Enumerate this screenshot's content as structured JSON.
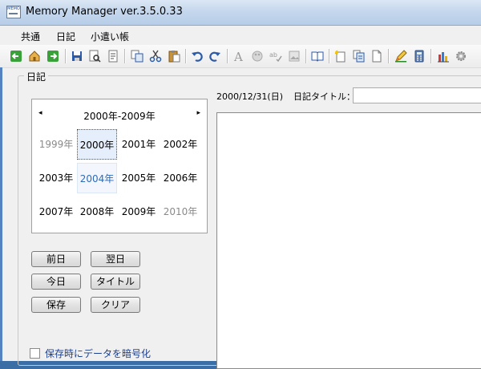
{
  "window": {
    "title": "Memory Manager ver.3.5.0.33",
    "icon": "memo-app-icon"
  },
  "menu": [
    "共通",
    "日記",
    "小遣い帳"
  ],
  "toolbar": {
    "icons": [
      "back-arrow-icon",
      "home-icon",
      "forward-arrow-icon",
      "save-icon",
      "print-preview-icon",
      "print-icon",
      "copy-icon",
      "cut-icon",
      "paste-icon",
      "undo-icon",
      "redo-icon",
      "font-icon",
      "color-icon",
      "spell-check-icon",
      "image-icon",
      "open-book-icon",
      "new-document-icon",
      "multi-document-icon",
      "document-icon",
      "edit-icon",
      "calculator-icon",
      "chart-icon",
      "gear-icon"
    ]
  },
  "diary": {
    "group_label": "日記",
    "calendar": {
      "range": "2000年-2009年",
      "prev": "◂",
      "next": "▸",
      "years": [
        [
          "1999年",
          "2000年",
          "2001年",
          "2002年"
        ],
        [
          "2003年",
          "2004年",
          "2005年",
          "2006年"
        ],
        [
          "2007年",
          "2008年",
          "2009年",
          "2010年"
        ]
      ],
      "selected": "2000年",
      "today": "2004年"
    },
    "buttons": {
      "prev_day": "前日",
      "next_day": "翌日",
      "today": "今日",
      "title": "タイトル",
      "save": "保存",
      "clear": "クリア"
    },
    "encrypt_label": "保存時にデータを暗号化",
    "date": "2000/12/31(日)",
    "title_label": "日記タイトル：",
    "title_value": ""
  },
  "colors": {
    "accent": "#2e6bb8",
    "link_text": "#1c3f8f",
    "selected_bg": "#e5eefb"
  }
}
